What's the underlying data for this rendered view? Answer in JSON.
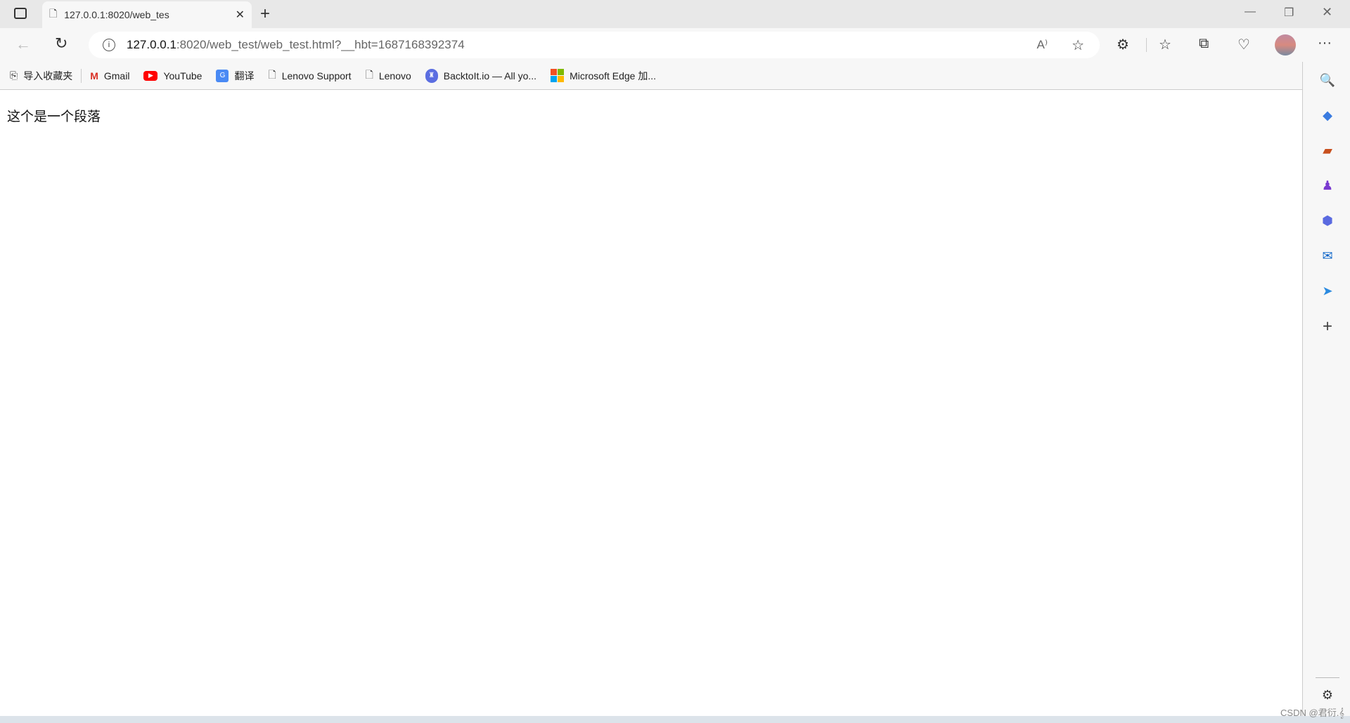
{
  "tab": {
    "title": "127.0.0.1:8020/web_test/web_test.html?__hbt=1687168392374",
    "display_title": "127.0.0.1:8020/web_tes"
  },
  "address": {
    "host": "127.0.0.1",
    "rest": ":8020/web_test/web_test.html?__hbt=1687168392374"
  },
  "bookmarks": [
    {
      "label": "导入收藏夹",
      "icon": "import-icon"
    },
    {
      "label": "Gmail",
      "icon": "gmail-icon"
    },
    {
      "label": "YouTube",
      "icon": "youtube-icon"
    },
    {
      "label": "翻译",
      "icon": "translate-icon"
    },
    {
      "label": "Lenovo Support",
      "icon": "page-icon"
    },
    {
      "label": "Lenovo",
      "icon": "page-icon"
    },
    {
      "label": "BacktoIt.io — All yo...",
      "icon": "backtoit-icon"
    },
    {
      "label": "Microsoft Edge 加...",
      "icon": "microsoft-icon"
    }
  ],
  "page": {
    "paragraph": "这个是一个段落"
  },
  "watermark": "CSDN @君衍.𝄞"
}
